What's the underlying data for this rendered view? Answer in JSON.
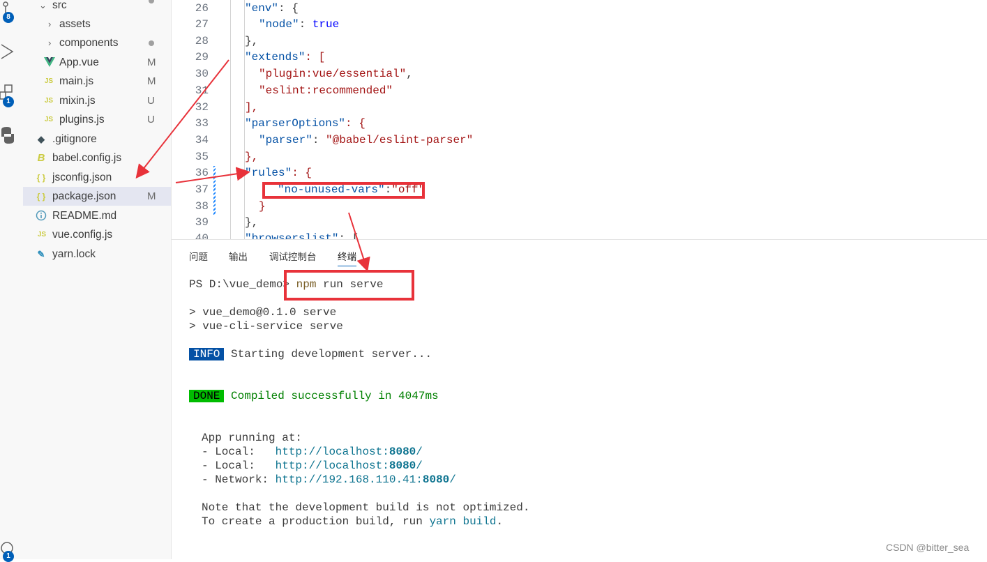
{
  "activity_bar": {
    "icons": [
      "source-control-icon",
      "run-debug-icon",
      "extensions-icon",
      "python-icon",
      "accounts-icon"
    ],
    "badges": [
      "8",
      "1",
      "1"
    ]
  },
  "explorer": {
    "items": [
      {
        "label": "src",
        "icon": "chevron-down-icon",
        "status": ""
      },
      {
        "label": "assets",
        "icon": "chevron-right-icon",
        "status": ""
      },
      {
        "label": "components",
        "icon": "chevron-right-icon",
        "status": ""
      },
      {
        "label": "App.vue",
        "icon": "vue-file-icon",
        "status": "M"
      },
      {
        "label": "main.js",
        "icon": "js-file-icon",
        "status": "M"
      },
      {
        "label": "mixin.js",
        "icon": "js-file-icon",
        "status": "U"
      },
      {
        "label": "plugins.js",
        "icon": "js-file-icon",
        "status": "U"
      },
      {
        "label": ".gitignore",
        "icon": "git-file-icon",
        "status": ""
      },
      {
        "label": "babel.config.js",
        "icon": "babel-file-icon",
        "status": ""
      },
      {
        "label": "jsconfig.json",
        "icon": "json-file-icon",
        "status": ""
      },
      {
        "label": "package.json",
        "icon": "json-file-icon",
        "status": "M"
      },
      {
        "label": "README.md",
        "icon": "info-file-icon",
        "status": ""
      },
      {
        "label": "vue.config.js",
        "icon": "js-file-icon",
        "status": ""
      },
      {
        "label": "yarn.lock",
        "icon": "yarn-file-icon",
        "status": ""
      }
    ],
    "js_badge": "JS",
    "json_badge": "{ }"
  },
  "editor": {
    "lines": [
      {
        "n": "26",
        "k": "\"env\"",
        "rest": ": {"
      },
      {
        "n": "27",
        "k": "\"node\"",
        "rest": ": ",
        "v": "true"
      },
      {
        "n": "28",
        "k": "",
        "rest": "},"
      },
      {
        "n": "29",
        "k": "\"extends\"",
        "rest": ": ["
      },
      {
        "n": "30",
        "k": "",
        "s": "\"plugin:vue/essential\"",
        "rest": ","
      },
      {
        "n": "31",
        "k": "",
        "s": "\"eslint:recommended\"",
        "rest": ""
      },
      {
        "n": "32",
        "k": "",
        "rest": "],"
      },
      {
        "n": "33",
        "k": "\"parserOptions\"",
        "rest": ": {"
      },
      {
        "n": "34",
        "k": "\"parser\"",
        "rest": ": ",
        "s2": "\"@babel/eslint-parser\""
      },
      {
        "n": "35",
        "k": "",
        "rest": "},"
      },
      {
        "n": "36",
        "k": "\"rules\"",
        "rest": ": {"
      },
      {
        "n": "37",
        "k": "\"no-unused-vars\"",
        "rest": ":",
        "s2": "\"off\""
      },
      {
        "n": "38",
        "k": "",
        "rest": "}"
      },
      {
        "n": "39",
        "k": "",
        "rest": "},"
      },
      {
        "n": "40",
        "k": "\"browserslist\"",
        "rest": ": ["
      }
    ]
  },
  "panel": {
    "tabs": [
      "问题",
      "输出",
      "调试控制台",
      "终端"
    ],
    "terminal": {
      "prompt": "PS D:\\vue_demo>",
      "command_bin": "npm",
      "command_args": " run serve",
      "line1": "> vue_demo@0.1.0 serve",
      "line2": "> vue-cli-service serve",
      "info_badge": "INFO",
      "info_text": " Starting development server...",
      "done_badge": "DONE",
      "done_text": " Compiled successfully in 4047ms",
      "app_running": "App running at:",
      "local_label": "- Local:   ",
      "local_url_a": "http://localhost:",
      "local_port": "8080",
      "url_tail": "/",
      "network_label": "- Network: ",
      "network_url_a": "http://192.168.110.41:",
      "note1": "Note that the development build is not optimized.",
      "note2_a": "To create a production build, run ",
      "note2_cmd": "yarn build",
      "note2_b": "."
    }
  },
  "watermark": "CSDN @bitter_sea",
  "colors": {
    "annotation_red": "#e8323a",
    "accent": "#005fb8"
  }
}
